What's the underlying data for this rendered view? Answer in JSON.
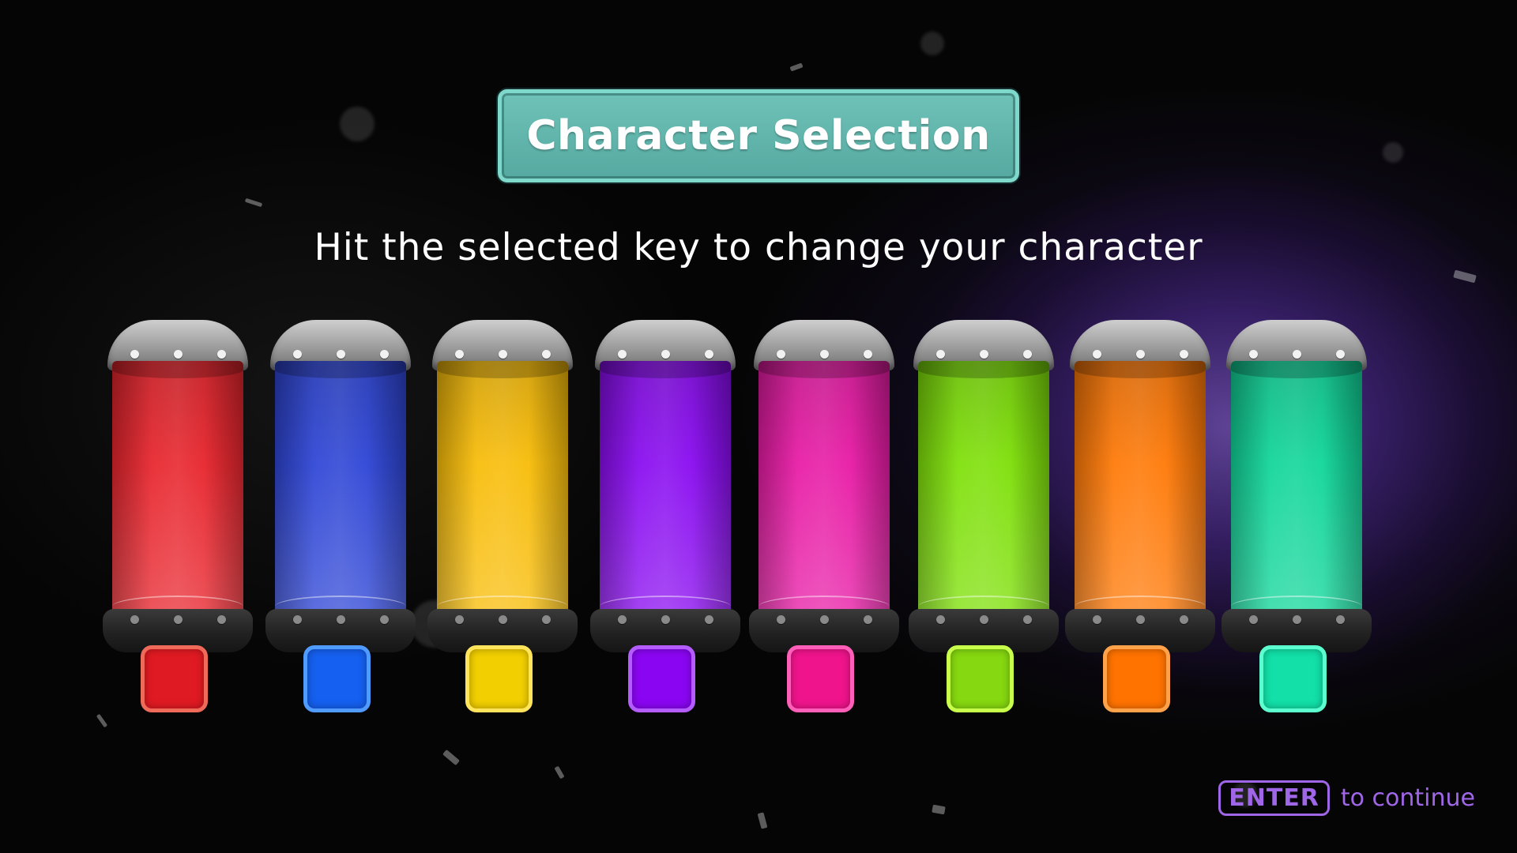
{
  "title": "Character Selection",
  "subtitle": "Hit the selected key to change your character",
  "characters": [
    {
      "name": "red",
      "tube_color": "#e8262e",
      "key_fill": "#e01a22",
      "key_border": "#f06a5a"
    },
    {
      "name": "blue",
      "tube_color": "#2f46d6",
      "key_fill": "#1560f0",
      "key_border": "#4f9bff"
    },
    {
      "name": "yellow",
      "tube_color": "#f8bd0a",
      "key_fill": "#f2cf00",
      "key_border": "#ffe45c"
    },
    {
      "name": "purple",
      "tube_color": "#8a0df0",
      "key_fill": "#8a06f2",
      "key_border": "#b45cff"
    },
    {
      "name": "magenta",
      "tube_color": "#e81ca6",
      "key_fill": "#f0148c",
      "key_border": "#ff5fb8"
    },
    {
      "name": "lime",
      "tube_color": "#7fe00a",
      "key_fill": "#86d810",
      "key_border": "#c8ff4a"
    },
    {
      "name": "orange",
      "tube_color": "#ff7a08",
      "key_fill": "#ff7300",
      "key_border": "#ffa24a"
    },
    {
      "name": "teal",
      "tube_color": "#12d69a",
      "key_fill": "#12e0a8",
      "key_border": "#5cffd0"
    }
  ],
  "footer": {
    "key_label": "ENTER",
    "text": "to continue",
    "accent": "#a066e8"
  }
}
